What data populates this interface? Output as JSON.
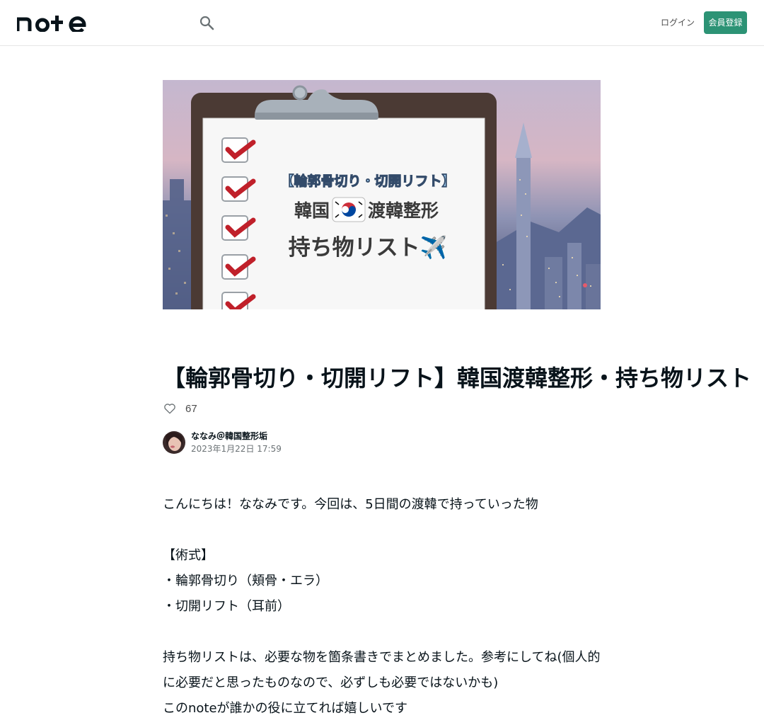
{
  "header": {
    "logo_text": "note",
    "search_icon": "search-icon",
    "login_label": "ログイン",
    "signup_label": "会員登録"
  },
  "hero": {
    "bracket_line": "【輪郭骨切り・切開リフト】",
    "line1_left": "韓国",
    "line1_right": "渡韓整形",
    "line2": "持ち物リスト✈️"
  },
  "article": {
    "title": "【輪郭骨切り・切開リフト】韓国渡韓整形・持ち物リスト",
    "like_count": "67",
    "author_name": "ななみ＠韓国整形垢",
    "date": "2023年1月22日 17:59",
    "paragraphs": [
      "こんにちは！ななみです。今回は、5日間の渡韓で持っていった物",
      "",
      "【術式】",
      "・輪郭骨切り（頬骨・エラ）",
      "・切開リフト（耳前）",
      "",
      "持ち物リストは、必要な物を箇条書きでまとめました。参考にしてね(個人的に必要だと思ったものなので、必ずしも必要ではないかも)",
      "このnoteが誰かの役に立てれば嬉しいです"
    ]
  },
  "colors": {
    "accent": "#2c9375",
    "text": "#08131a",
    "muted": "#6b7275",
    "border": "#e6e6e6"
  }
}
